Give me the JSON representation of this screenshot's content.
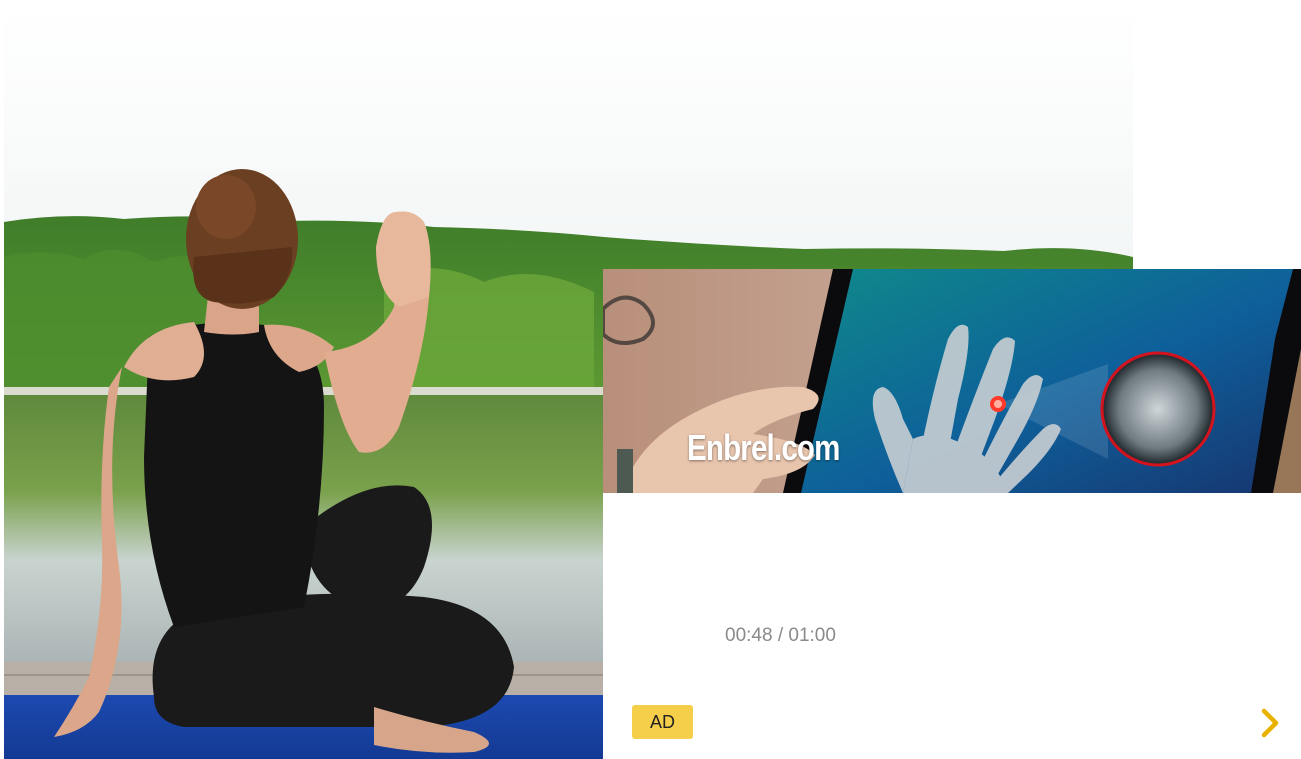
{
  "background": {
    "scene": "yoga-by-lake-photo"
  },
  "ad": {
    "brand_text": "Enbrel.com",
    "time_current": "00:48",
    "time_separator": " / ",
    "time_total": "01:00",
    "badge_label": "AD",
    "next_icon": "chevron-right-icon",
    "colors": {
      "badge_bg": "#f5cf4a",
      "chevron": "#e9b200",
      "timer_text": "#8a8a8a"
    }
  }
}
